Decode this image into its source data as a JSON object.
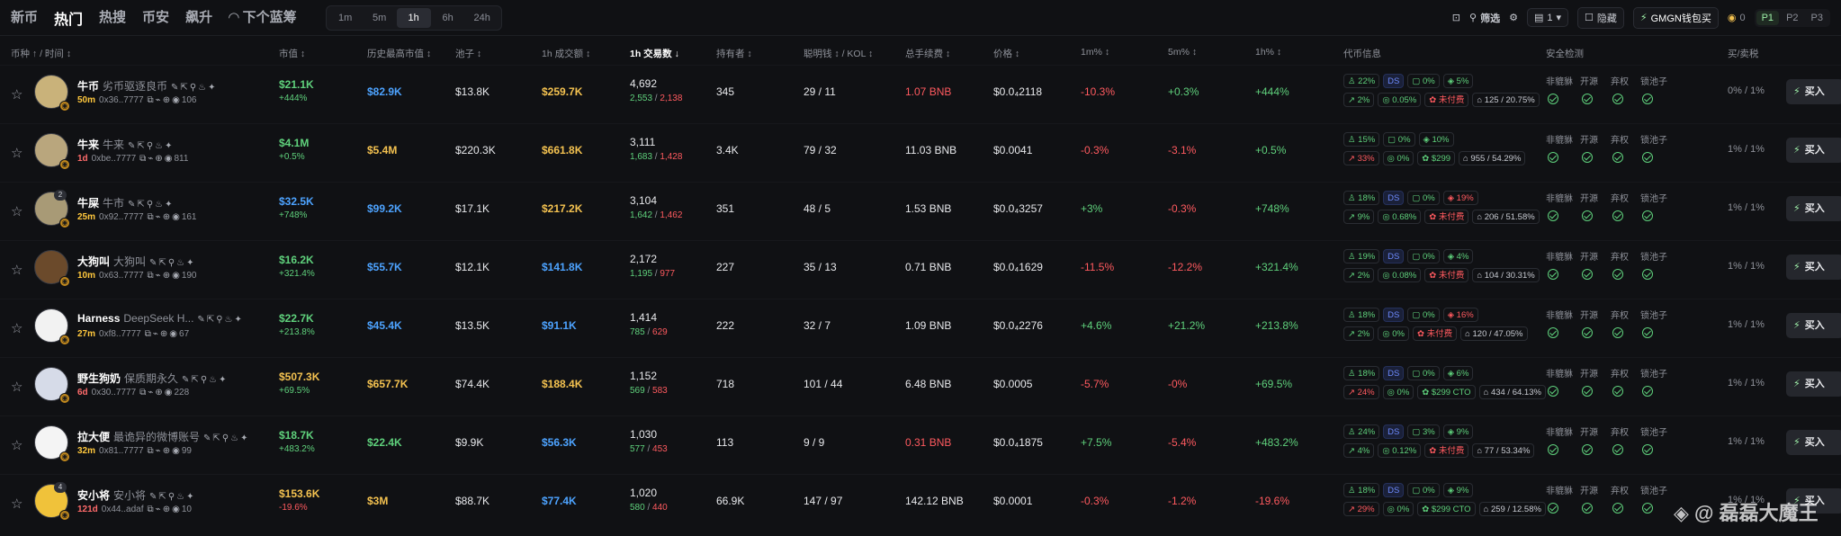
{
  "nav": {
    "tabs": [
      {
        "label": "新币",
        "active": false
      },
      {
        "label": "热门",
        "active": true
      },
      {
        "label": "热搜",
        "active": false
      },
      {
        "label": "币安",
        "active": false
      },
      {
        "label": "飙升",
        "active": false
      },
      {
        "label": "下个蓝筹",
        "active": false
      }
    ],
    "timeframes": [
      {
        "label": "1m",
        "active": false
      },
      {
        "label": "5m",
        "active": false
      },
      {
        "label": "1h",
        "active": true
      },
      {
        "label": "6h",
        "active": false
      },
      {
        "label": "24h",
        "active": false
      }
    ],
    "filter_label": "筛选",
    "count_label": "1",
    "hide_label": "隐藏",
    "gmgn_label": "GMGN钱包买",
    "gmgn_value": "0",
    "pages": [
      {
        "label": "P1",
        "active": true
      },
      {
        "label": "P2",
        "active": false
      },
      {
        "label": "P3",
        "active": false
      }
    ]
  },
  "columns": {
    "coin_time": "币种 ↑ / 时间 ↕",
    "mcap": "市值 ↕",
    "ath": "历史最高市值 ↕",
    "pool": "池子 ↕",
    "vol": "1h 成交额 ↕",
    "tx": "1h 交易数 ↓",
    "holders": "持有者 ↕",
    "smart": "聪明钱 ↕ / KOL ↕",
    "fee": "总手续费 ↕",
    "price": "价格 ↕",
    "p1m": "1m% ↕",
    "p5m": "5m% ↕",
    "p1h": "1h% ↕",
    "info": "代币信息",
    "security": "安全检测",
    "tax": "买/卖税"
  },
  "security_labels": [
    "非貔貅",
    "开源",
    "弃权",
    "锁池子"
  ],
  "buy_label": "买入",
  "rows": [
    {
      "name": "牛币",
      "sub": "劣币驱逐良币",
      "age": "50m",
      "age_color": "yellow",
      "addr": "0x36..7777",
      "views": "106",
      "avnum": "",
      "mc": "$21.1K",
      "mc_chg": "+444%",
      "mc_color": "green",
      "mc_chg_color": "green",
      "ath": "$82.9K",
      "ath_color": "blue",
      "pool": "$13.8K",
      "vol": "$259.7K",
      "vol_color": "yellow",
      "tx": "4,692",
      "tx_buy": "2,553",
      "tx_sell": "2,138",
      "holders": "345",
      "smart": "29 / 11",
      "fee": "1.07 BNB",
      "fee_color": "red",
      "price": "$0.0₄2118",
      "p1m": "-10.3%",
      "p1m_c": "red",
      "p5m": "+0.3%",
      "p5m_c": "green",
      "p1h": "+444%",
      "p1h_c": "green",
      "t1": [
        {
          "t": "♙ 22%",
          "c": "g"
        },
        {
          "t": "DS",
          "c": "b"
        },
        {
          "t": "▢ 0%",
          "c": "g"
        },
        {
          "t": "◈ 5%",
          "c": "g"
        }
      ],
      "t2": [
        {
          "t": "↗ 2%",
          "c": "g"
        },
        {
          "t": "◎ 0.05%",
          "c": "g"
        },
        {
          "t": "✿ 未付费",
          "c": "r"
        },
        {
          "t": "⌂ 125 / 20.75%",
          "c": "w"
        }
      ],
      "tax": "0% / 1%",
      "avbg": "#c9b27a"
    },
    {
      "name": "牛来",
      "sub": "牛来",
      "age": "1d",
      "age_color": "red",
      "addr": "0xbe..7777",
      "views": "811",
      "avnum": "",
      "mc": "$4.1M",
      "mc_chg": "+0.5%",
      "mc_color": "green",
      "mc_chg_color": "green",
      "ath": "$5.4M",
      "ath_color": "yellow",
      "pool": "$220.3K",
      "vol": "$661.8K",
      "vol_color": "yellow",
      "tx": "3,111",
      "tx_buy": "1,683",
      "tx_sell": "1,428",
      "holders": "3.4K",
      "smart": "79 / 32",
      "fee": "11.03 BNB",
      "fee_color": "white",
      "price": "$0.0041",
      "p1m": "-0.3%",
      "p1m_c": "red",
      "p5m": "-3.1%",
      "p5m_c": "red",
      "p1h": "+0.5%",
      "p1h_c": "green",
      "t1": [
        {
          "t": "♙ 15%",
          "c": "g"
        },
        {
          "t": "▢ 0%",
          "c": "g"
        },
        {
          "t": "◈ 10%",
          "c": "g"
        }
      ],
      "t2": [
        {
          "t": "↗ 33%",
          "c": "r"
        },
        {
          "t": "◎ 0%",
          "c": "g"
        },
        {
          "t": "✿ $299",
          "c": "g"
        },
        {
          "t": "⌂ 955 / 54.29%",
          "c": "w"
        }
      ],
      "tax": "1% / 1%",
      "avbg": "#b9a67d"
    },
    {
      "name": "牛屎",
      "sub": "牛市",
      "age": "25m",
      "age_color": "yellow",
      "addr": "0x92..7777",
      "views": "161",
      "avnum": "2",
      "mc": "$32.5K",
      "mc_chg": "+748%",
      "mc_color": "blue",
      "mc_chg_color": "green",
      "ath": "$99.2K",
      "ath_color": "blue",
      "pool": "$17.1K",
      "vol": "$217.2K",
      "vol_color": "yellow",
      "tx": "3,104",
      "tx_buy": "1,642",
      "tx_sell": "1,462",
      "holders": "351",
      "smart": "48 / 5",
      "fee": "1.53 BNB",
      "fee_color": "white",
      "price": "$0.0₄3257",
      "p1m": "+3%",
      "p1m_c": "green",
      "p5m": "-0.3%",
      "p5m_c": "red",
      "p1h": "+748%",
      "p1h_c": "green",
      "t1": [
        {
          "t": "♙ 18%",
          "c": "g"
        },
        {
          "t": "DS",
          "c": "b"
        },
        {
          "t": "▢ 0%",
          "c": "g"
        },
        {
          "t": "◈ 19%",
          "c": "r"
        }
      ],
      "t2": [
        {
          "t": "↗ 9%",
          "c": "g"
        },
        {
          "t": "◎ 0.68%",
          "c": "g"
        },
        {
          "t": "✿ 未付费",
          "c": "r"
        },
        {
          "t": "⌂ 206 / 51.58%",
          "c": "w"
        }
      ],
      "tax": "1% / 1%",
      "avbg": "#a89a76"
    },
    {
      "name": "大狗叫",
      "sub": "大狗叫",
      "age": "10m",
      "age_color": "yellow",
      "addr": "0x63..7777",
      "views": "190",
      "avnum": "",
      "mc": "$16.2K",
      "mc_chg": "+321.4%",
      "mc_color": "green",
      "mc_chg_color": "green",
      "ath": "$55.7K",
      "ath_color": "blue",
      "pool": "$12.1K",
      "vol": "$141.8K",
      "vol_color": "blue",
      "tx": "2,172",
      "tx_buy": "1,195",
      "tx_sell": "977",
      "holders": "227",
      "smart": "35 / 13",
      "fee": "0.71 BNB",
      "fee_color": "white",
      "price": "$0.0₄1629",
      "p1m": "-11.5%",
      "p1m_c": "red",
      "p5m": "-12.2%",
      "p5m_c": "red",
      "p1h": "+321.4%",
      "p1h_c": "green",
      "t1": [
        {
          "t": "♙ 19%",
          "c": "g"
        },
        {
          "t": "DS",
          "c": "b"
        },
        {
          "t": "▢ 0%",
          "c": "g"
        },
        {
          "t": "◈ 4%",
          "c": "g"
        }
      ],
      "t2": [
        {
          "t": "↗ 2%",
          "c": "g"
        },
        {
          "t": "◎ 0.08%",
          "c": "g"
        },
        {
          "t": "✿ 未付费",
          "c": "r"
        },
        {
          "t": "⌂ 104 / 30.31%",
          "c": "w"
        }
      ],
      "tax": "1% / 1%",
      "avbg": "#6b4a2b"
    },
    {
      "name": "Harness",
      "sub": "DeepSeek H...",
      "age": "27m",
      "age_color": "yellow",
      "addr": "0xf8..7777",
      "views": "67",
      "avnum": "",
      "mc": "$22.7K",
      "mc_chg": "+213.8%",
      "mc_color": "green",
      "mc_chg_color": "green",
      "ath": "$45.4K",
      "ath_color": "blue",
      "pool": "$13.5K",
      "vol": "$91.1K",
      "vol_color": "blue",
      "tx": "1,414",
      "tx_buy": "785",
      "tx_sell": "629",
      "holders": "222",
      "smart": "32 / 7",
      "fee": "1.09 BNB",
      "fee_color": "white",
      "price": "$0.0₄2276",
      "p1m": "+4.6%",
      "p1m_c": "green",
      "p5m": "+21.2%",
      "p5m_c": "green",
      "p1h": "+213.8%",
      "p1h_c": "green",
      "t1": [
        {
          "t": "♙ 18%",
          "c": "g"
        },
        {
          "t": "DS",
          "c": "b"
        },
        {
          "t": "▢ 0%",
          "c": "g"
        },
        {
          "t": "◈ 16%",
          "c": "r"
        }
      ],
      "t2": [
        {
          "t": "↗ 2%",
          "c": "g"
        },
        {
          "t": "◎ 0%",
          "c": "g"
        },
        {
          "t": "✿ 未付费",
          "c": "r"
        },
        {
          "t": "⌂ 120 / 47.05%",
          "c": "w"
        }
      ],
      "tax": "1% / 1%",
      "avbg": "#f2f2f2"
    },
    {
      "name": "野生狗奶",
      "sub": "保质期永久",
      "age": "6d",
      "age_color": "red",
      "addr": "0x30..7777",
      "views": "228",
      "avnum": "",
      "mc": "$507.3K",
      "mc_chg": "+69.5%",
      "mc_color": "yellow",
      "mc_chg_color": "green",
      "ath": "$657.7K",
      "ath_color": "yellow",
      "pool": "$74.4K",
      "vol": "$188.4K",
      "vol_color": "yellow",
      "tx": "1,152",
      "tx_buy": "569",
      "tx_sell": "583",
      "holders": "718",
      "smart": "101 / 44",
      "fee": "6.48 BNB",
      "fee_color": "white",
      "price": "$0.0005",
      "p1m": "-5.7%",
      "p1m_c": "red",
      "p5m": "-0%",
      "p5m_c": "red",
      "p1h": "+69.5%",
      "p1h_c": "green",
      "t1": [
        {
          "t": "♙ 18%",
          "c": "g"
        },
        {
          "t": "DS",
          "c": "b"
        },
        {
          "t": "▢ 0%",
          "c": "g"
        },
        {
          "t": "◈ 6%",
          "c": "g"
        }
      ],
      "t2": [
        {
          "t": "↗ 24%",
          "c": "r"
        },
        {
          "t": "◎ 0%",
          "c": "g"
        },
        {
          "t": "✿ $299 CTO",
          "c": "g"
        },
        {
          "t": "⌂ 434 / 64.13%",
          "c": "w"
        }
      ],
      "tax": "1% / 1%",
      "avbg": "#d6dbe8"
    },
    {
      "name": "拉大便",
      "sub": "最诡异的微博账号",
      "age": "32m",
      "age_color": "yellow",
      "addr": "0x81..7777",
      "views": "99",
      "avnum": "",
      "mc": "$18.7K",
      "mc_chg": "+483.2%",
      "mc_color": "green",
      "mc_chg_color": "green",
      "ath": "$22.4K",
      "ath_color": "green",
      "pool": "$9.9K",
      "vol": "$56.3K",
      "vol_color": "blue",
      "tx": "1,030",
      "tx_buy": "577",
      "tx_sell": "453",
      "holders": "113",
      "smart": "9 / 9",
      "fee": "0.31 BNB",
      "fee_color": "red",
      "price": "$0.0₄1875",
      "p1m": "+7.5%",
      "p1m_c": "green",
      "p5m": "-5.4%",
      "p5m_c": "red",
      "p1h": "+483.2%",
      "p1h_c": "green",
      "t1": [
        {
          "t": "♙ 24%",
          "c": "g"
        },
        {
          "t": "DS",
          "c": "b"
        },
        {
          "t": "▢ 3%",
          "c": "g"
        },
        {
          "t": "◈ 9%",
          "c": "g"
        }
      ],
      "t2": [
        {
          "t": "↗ 4%",
          "c": "g"
        },
        {
          "t": "◎ 0.12%",
          "c": "g"
        },
        {
          "t": "✿ 未付费",
          "c": "r"
        },
        {
          "t": "⌂ 77 / 53.34%",
          "c": "w"
        }
      ],
      "tax": "1% / 1%",
      "avbg": "#f4f4f4"
    },
    {
      "name": "安小将",
      "sub": "安小将",
      "age": "121d",
      "age_color": "red",
      "addr": "0x44..adaf",
      "views": "10",
      "avnum": "4",
      "mc": "$153.6K",
      "mc_chg": "-19.6%",
      "mc_color": "yellow",
      "mc_chg_color": "red",
      "ath": "$3M",
      "ath_color": "yellow",
      "pool": "$88.7K",
      "vol": "$77.4K",
      "vol_color": "blue",
      "tx": "1,020",
      "tx_buy": "580",
      "tx_sell": "440",
      "holders": "66.9K",
      "smart": "147 / 97",
      "fee": "142.12 BNB",
      "fee_color": "white",
      "price": "$0.0001",
      "p1m": "-0.3%",
      "p1m_c": "red",
      "p5m": "-1.2%",
      "p5m_c": "red",
      "p1h": "-19.6%",
      "p1h_c": "red",
      "t1": [
        {
          "t": "♙ 18%",
          "c": "g"
        },
        {
          "t": "DS",
          "c": "b"
        },
        {
          "t": "▢ 0%",
          "c": "g"
        },
        {
          "t": "◈ 9%",
          "c": "g"
        }
      ],
      "t2": [
        {
          "t": "↗ 29%",
          "c": "r"
        },
        {
          "t": "◎ 0%",
          "c": "g"
        },
        {
          "t": "✿ $299 CTO",
          "c": "g"
        },
        {
          "t": "⌂ 259 / 12.58%",
          "c": "w"
        }
      ],
      "tax": "1% / 1%",
      "avbg": "#f0c23a"
    }
  ],
  "watermark": "◈ @ 磊磊大魔王"
}
